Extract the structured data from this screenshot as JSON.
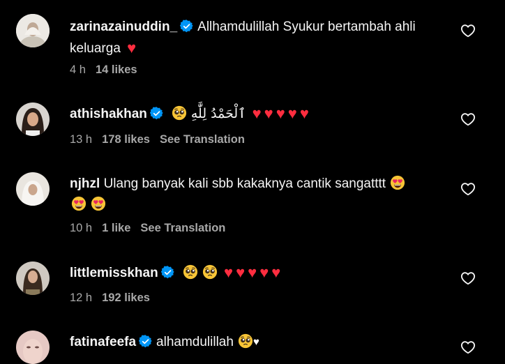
{
  "icons": {
    "verified": "verified-badge-icon",
    "like": "heart-outline-icon",
    "red_heart": "red-heart-emoji",
    "pleading": "pleading-face-emoji",
    "heart_eyes": "heart-eyes-emoji",
    "white_heart": "white-heart-emoji"
  },
  "colors": {
    "verified": "#0095f6",
    "heart": "#ff2d3f",
    "meta": "#a8a8a8"
  },
  "comments": [
    {
      "username": "zarinazainuddin_",
      "text": "Allhamdulillah Syukur bertambah ahli keluarga",
      "time": "4 h",
      "likes": "14 likes"
    },
    {
      "username": "athishakhan",
      "text": "ٱلْحَمْدُ لِلَّٰهِ",
      "time": "13 h",
      "likes": "178 likes",
      "translation": "See Translation"
    },
    {
      "username": "njhzl",
      "text": "Ulang banyak kali sbb kakaknya cantik sangatttt",
      "time": "10 h",
      "likes": "1 like",
      "translation": "See Translation"
    },
    {
      "username": "littlemisskhan",
      "text": "",
      "time": "12 h",
      "likes": "192 likes"
    },
    {
      "username": "fatinafeefa",
      "text": "alhamdulillah"
    }
  ]
}
